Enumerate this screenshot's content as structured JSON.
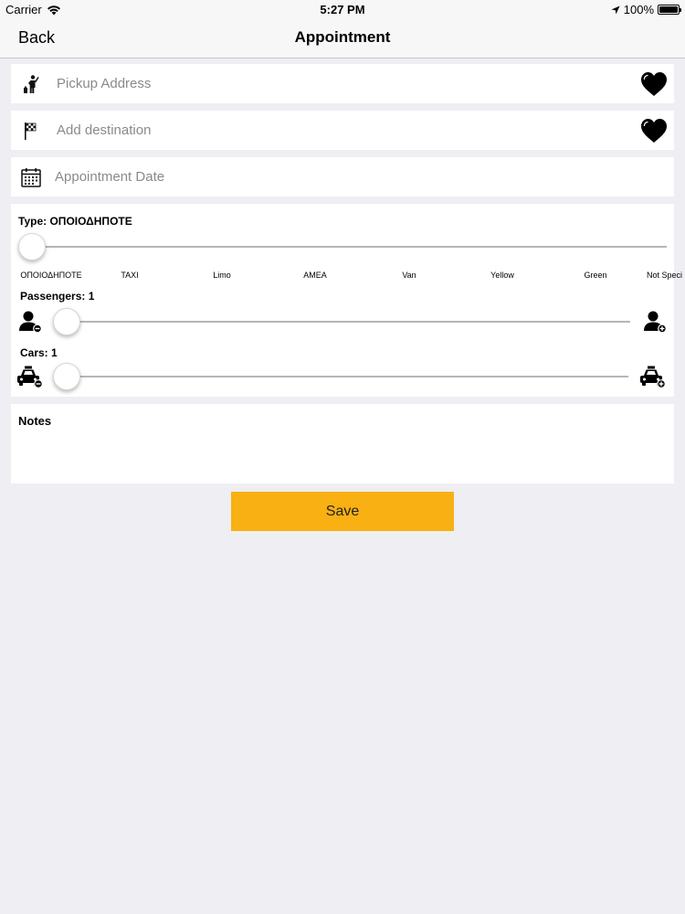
{
  "status_bar": {
    "carrier": "Carrier",
    "time": "5:27 PM",
    "battery": "100%",
    "battery_level": 1.0
  },
  "nav": {
    "back_label": "Back",
    "title": "Appointment"
  },
  "pickup": {
    "placeholder": "Pickup Address",
    "value": "",
    "icon": "hail-person-icon",
    "favorite_icon": "heart-icon"
  },
  "destination": {
    "placeholder": "Add destination",
    "value": "",
    "icon": "checkered-flag-icon",
    "favorite_icon": "heart-icon"
  },
  "appointment_date": {
    "placeholder": "Appointment Date",
    "value": "",
    "icon": "calendar-icon"
  },
  "type": {
    "label": "Type: ΟΠΟΙΟΔΗΠΟΤΕ",
    "options": [
      "ΟΠΟΙΟΔΗΠΟΤΕ",
      "TAXI",
      "Limo",
      "AMEA",
      "Van",
      "Yellow",
      "Green",
      "Not Speci"
    ],
    "selected_index": 0
  },
  "passengers": {
    "label": "Passengers: 1",
    "value": 1,
    "decrease_icon": "person-minus-icon",
    "increase_icon": "person-plus-icon"
  },
  "cars": {
    "label": "Cars: 1",
    "value": 1,
    "decrease_icon": "taxi-minus-icon",
    "increase_icon": "taxi-plus-icon"
  },
  "notes": {
    "label": "Notes",
    "value": ""
  },
  "save": {
    "label": "Save"
  },
  "colors": {
    "accent": "#f8b012",
    "background": "#efeef3",
    "panel": "#ffffff"
  }
}
